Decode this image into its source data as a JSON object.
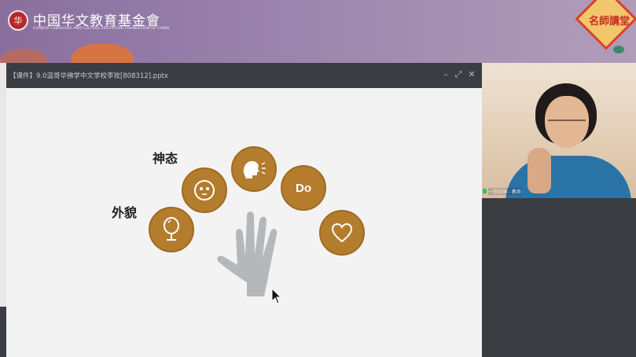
{
  "banner": {
    "org_name": "中国华文教育基金會",
    "org_subtitle": "CHINESE LANGUAGE AND CULTURE EDUCATION FOUNDATION OF CHINA",
    "logo_glyph": "华",
    "badge_text": "名師講堂"
  },
  "window": {
    "title": "【课件】9.0温哥华佛学中文学校李玫[808312].pptx",
    "minimize": "–",
    "restore": "⤢",
    "close": "✕"
  },
  "slide": {
    "label_demeanor": "神态",
    "label_appearance": "外貌",
    "do_label": "Do"
  },
  "video": {
    "participant_name": "一陈晓琳 - 教务"
  },
  "colors": {
    "accent_circle": "#b47d2e",
    "hand": "#b5b8bb",
    "titlebar": "#3a3d41"
  },
  "icons": [
    "mirror-icon",
    "face-icon",
    "speaking-head-icon",
    "heart-icon",
    "hand-icon",
    "cursor-icon"
  ]
}
